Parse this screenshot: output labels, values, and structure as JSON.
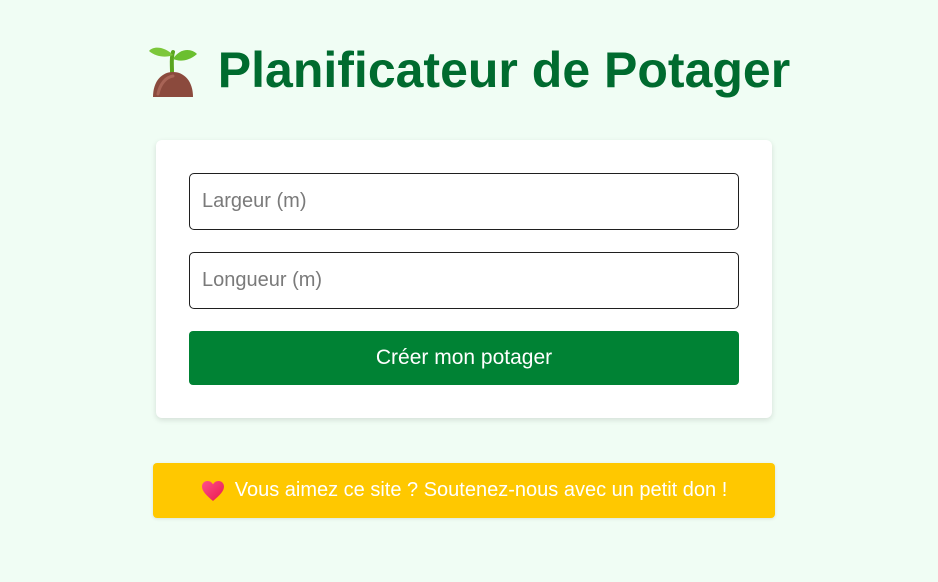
{
  "header": {
    "icon": "sprout-icon",
    "title": "Planificateur de Potager"
  },
  "form": {
    "width_placeholder": "Largeur (m)",
    "width_value": "",
    "length_placeholder": "Longueur (m)",
    "length_value": "",
    "submit_label": "Créer mon potager"
  },
  "donate": {
    "icon": "heart-icon",
    "label": "Vous aimez ce site ? Soutenez-nous avec un petit don !"
  },
  "colors": {
    "background": "#f0fdf4",
    "title": "#006b2f",
    "primary_button": "#008234",
    "donate_button": "#ffc800"
  }
}
